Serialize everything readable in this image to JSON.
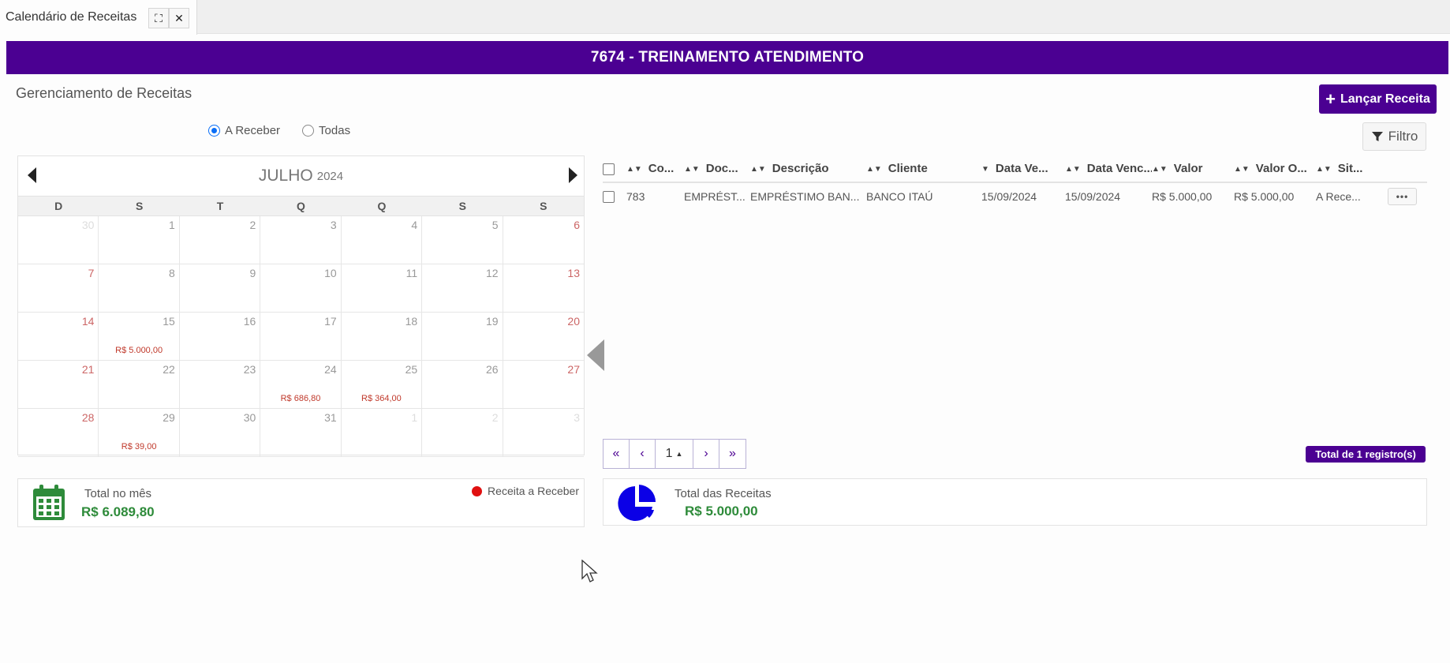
{
  "tab": {
    "title": "Calendário de Receitas",
    "expand_glyph": "⛶",
    "close_glyph": "✕"
  },
  "banner": {
    "title": "7674 - TREINAMENTO ATENDIMENTO"
  },
  "header": {
    "page_title": "Gerenciamento de Receitas",
    "add_button": "Lançar Receita",
    "filter_button": "Filtro"
  },
  "radios": [
    {
      "label": "A Receber",
      "checked": true
    },
    {
      "label": "Todas",
      "checked": false
    }
  ],
  "calendar": {
    "month": "JULHO",
    "year": "2024",
    "weekdays": [
      "D",
      "S",
      "T",
      "Q",
      "Q",
      "S",
      "S"
    ],
    "days": [
      {
        "n": "30",
        "other": true
      },
      {
        "n": "1"
      },
      {
        "n": "2"
      },
      {
        "n": "3"
      },
      {
        "n": "4"
      },
      {
        "n": "5"
      },
      {
        "n": "6"
      },
      {
        "n": "7"
      },
      {
        "n": "8"
      },
      {
        "n": "9"
      },
      {
        "n": "10"
      },
      {
        "n": "11"
      },
      {
        "n": "12"
      },
      {
        "n": "13"
      },
      {
        "n": "14"
      },
      {
        "n": "15",
        "amount": "R$ 5.000,00"
      },
      {
        "n": "16"
      },
      {
        "n": "17"
      },
      {
        "n": "18"
      },
      {
        "n": "19"
      },
      {
        "n": "20"
      },
      {
        "n": "21"
      },
      {
        "n": "22"
      },
      {
        "n": "23"
      },
      {
        "n": "24",
        "amount": "R$ 686,80"
      },
      {
        "n": "25",
        "amount": "R$ 364,00"
      },
      {
        "n": "26"
      },
      {
        "n": "27"
      },
      {
        "n": "28"
      },
      {
        "n": "29",
        "amount": "R$ 39,00"
      },
      {
        "n": "30"
      },
      {
        "n": "31"
      },
      {
        "n": "1",
        "other": true
      },
      {
        "n": "2",
        "other": true
      },
      {
        "n": "3",
        "other": true
      }
    ]
  },
  "table": {
    "columns": [
      "Co...",
      "Doc...",
      "Descrição",
      "Cliente",
      "Data Ve...",
      "Data Venc....",
      "Valor",
      "Valor O...",
      "Sit..."
    ],
    "rows": [
      [
        "783",
        "EMPRÉST...",
        "EMPRÉSTIMO BAN...",
        "BANCO ITAÚ",
        "15/09/2024",
        "15/09/2024",
        "R$ 5.000,00",
        "R$ 5.000,00",
        "A Rece..."
      ]
    ],
    "row_action_glyph": "•••"
  },
  "pagination": {
    "first": "«",
    "prev": "‹",
    "current": "1",
    "next": "›",
    "last": "»",
    "total_label": "Total de 1 registro(s)"
  },
  "summary_month": {
    "label": "Total no mês",
    "value": "R$ 6.089,80",
    "legend": "Receita a Receber",
    "icon": "calendar-icon"
  },
  "summary_total": {
    "label": "Total das Receitas",
    "value": "R$ 5.000,00",
    "icon": "pie-chart-icon"
  },
  "colors": {
    "brand": "#4b0092",
    "positive": "#2e8b3a",
    "alert": "#e01010",
    "chart_blue": "#0b00e6"
  }
}
